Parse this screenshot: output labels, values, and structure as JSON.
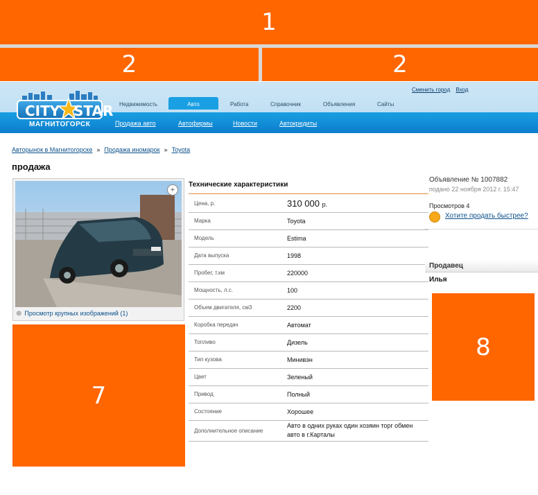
{
  "ads": {
    "top": "1",
    "middle_left": "2",
    "middle_right": "2",
    "left_bottom": "7",
    "right": "8"
  },
  "header": {
    "logo": {
      "brand_left": "CITY",
      "brand_right": "STAR",
      "city": "МАГНИТОГОРСК"
    },
    "top_links": [
      "Сменить город",
      "Вход"
    ],
    "main_tabs": [
      {
        "label": "Недвижимость",
        "active": false
      },
      {
        "label": "Авто",
        "active": true
      },
      {
        "label": "Работа",
        "active": false
      },
      {
        "label": "Справочник",
        "active": false
      },
      {
        "label": "Объявления",
        "active": false
      },
      {
        "label": "Сайты",
        "active": false
      }
    ],
    "sub_links": [
      "Продажа авто",
      "Автофирмы",
      "Новости",
      "Автокредиты"
    ]
  },
  "breadcrumb": [
    "Авторынок в Магнитогорске",
    "Продажа иномарок",
    "Toyota"
  ],
  "page_title": "продажа",
  "photo": {
    "caption": "Просмотр крупных изображений (1)",
    "zoom": "+"
  },
  "specs": {
    "title": "Технические характеристики",
    "price": {
      "label": "Цена, р.",
      "value": "310 000",
      "unit": "р."
    },
    "rows": [
      {
        "label": "Марка",
        "value": "Toyota"
      },
      {
        "label": "Модель",
        "value": "Estima"
      },
      {
        "label": "Дата выпуска",
        "value": "1998"
      },
      {
        "label": "Пробег, т.км",
        "value": "220000"
      },
      {
        "label": "Мощность, л.с.",
        "value": "100"
      },
      {
        "label": "Объем двигателя, см3",
        "value": "2200"
      },
      {
        "label": "Коробка передач",
        "value": "Автомат"
      },
      {
        "label": "Топливо",
        "value": "Дизель"
      },
      {
        "label": "Тип кузова",
        "value": "Минивэн"
      },
      {
        "label": "Цвет",
        "value": "Зеленый"
      },
      {
        "label": "Привод",
        "value": "Полный"
      },
      {
        "label": "Состояние",
        "value": "Хорошее"
      }
    ],
    "description": {
      "label": "Дополнительное описание",
      "line1": "Авто в одних руках один хозяин торг обмен",
      "line2": "авто в г.Карталы"
    }
  },
  "ad_info": {
    "number": "Объявление № 1007882",
    "date": "подано 22 ноября 2012 г. 15:47",
    "views": "Просмотров 4",
    "sell_faster": "Хотите продать быстрее?",
    "seller_label": "Продавец",
    "seller_name": "Илья"
  }
}
